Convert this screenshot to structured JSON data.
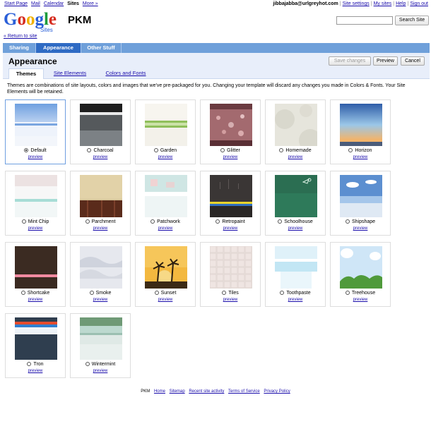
{
  "topbar": {
    "links": [
      "Start Page",
      "Mail",
      "Calendar",
      "Sites",
      "More »"
    ],
    "current": "Sites",
    "email": "jibbajabba@urlgreyhot.com",
    "right_links": [
      "Site settings",
      "My sites",
      "Help",
      "Sign out"
    ]
  },
  "logo": {
    "word": "Google",
    "sub": "Sites"
  },
  "site_name": "PKM",
  "return_link": "« Return to site",
  "search": {
    "value": "",
    "button": "Search Site"
  },
  "tabs": [
    "Sharing",
    "Appearance",
    "Other Stuff"
  ],
  "active_tab": "Appearance",
  "page": {
    "title": "Appearance",
    "buttons": {
      "save": "Save changes",
      "preview": "Preview",
      "cancel": "Cancel"
    },
    "subtabs": [
      "Themes",
      "Site Elements",
      "Colors and Fonts"
    ]
  },
  "intro": "Themes are combinations of site layouts, colors and images that we've pre-packaged for you. Changing your template will discard any changes you made in Colors & Fonts. Your Site Elements will be retained.",
  "preview_label": "preview",
  "selected_theme": "Default",
  "themes": [
    "Default",
    "Charcoal",
    "Garden",
    "Glitter",
    "Homemade",
    "Horizon",
    "Mint Chip",
    "Parchment",
    "Patchwork",
    "Retropaint",
    "Schoolhouse",
    "Shipshape",
    "Shortcake",
    "Smoke",
    "Sunset",
    "Tiles",
    "Toothpaste",
    "Treehouse",
    "Tron",
    "Wintermint"
  ],
  "footer": {
    "site": "PKM",
    "links": [
      "Home",
      "Sitemap",
      "Recent site activity",
      "Terms of Service",
      "Privacy Policy"
    ]
  }
}
